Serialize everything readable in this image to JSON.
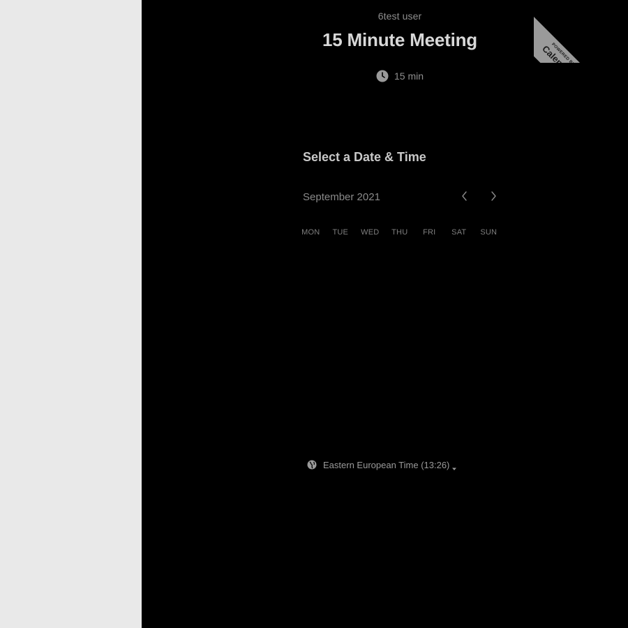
{
  "header": {
    "organizer": "6test user",
    "event_title": "15 Minute Meeting",
    "duration": "15 min"
  },
  "badge": {
    "small": "POWERED BY",
    "brand": "Calendly"
  },
  "calendar": {
    "section_title": "Select a Date & Time",
    "month": "September 2021",
    "weekdays": [
      "MON",
      "TUE",
      "WED",
      "THU",
      "FRI",
      "SAT",
      "SUN"
    ]
  },
  "timezone": {
    "label": "Eastern European Time (13:26)"
  },
  "icons": {
    "clock": "clock-icon",
    "prev": "chevron-left-icon",
    "next": "chevron-right-icon",
    "globe": "globe-icon",
    "caret": "caret-down-icon"
  },
  "colors": {
    "panel_bg": "#000000",
    "side_bg": "#e9e9e9",
    "badge_bg": "#9a9a9a"
  }
}
